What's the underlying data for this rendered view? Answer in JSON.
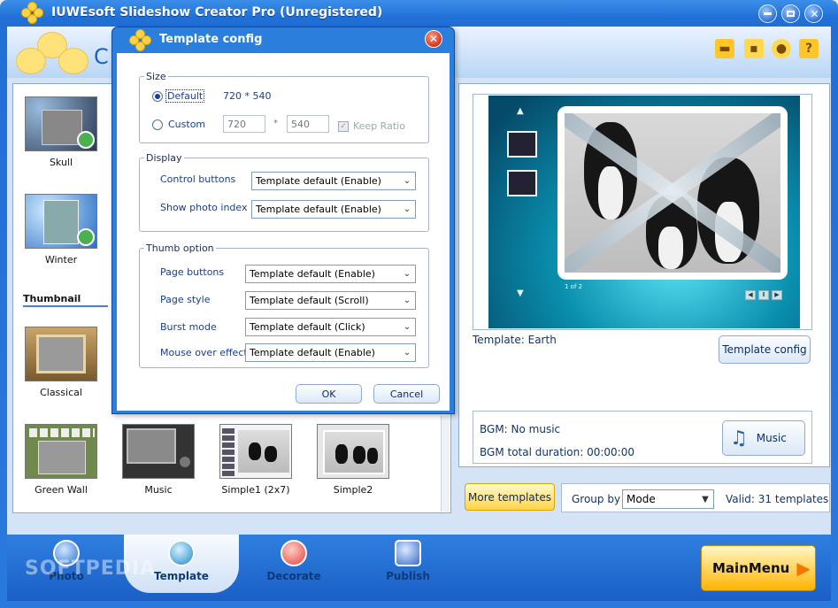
{
  "window": {
    "title": "IUWEsoft Slideshow Creator Pro (Unregistered)",
    "header_letter": "C"
  },
  "left_panel": {
    "templates": [
      {
        "label": "Skull"
      },
      {
        "label": "Winter"
      },
      {
        "label": "Classical"
      },
      {
        "label": "Green Wall"
      },
      {
        "label": "Music"
      },
      {
        "label": "Simple1 (2x7)"
      },
      {
        "label": "Simple2"
      }
    ],
    "section_title": "Thumbnail"
  },
  "preview": {
    "page_indicator": "1 of 2",
    "template_text": "Template: Earth",
    "template_config_button": "Template config"
  },
  "bgm": {
    "music": "BGM: No music",
    "duration": "BGM total duration: 00:00:00",
    "music_button": "Music"
  },
  "bottom_row": {
    "more_templates": "More templates",
    "group_by_label": "Group by",
    "group_by_value": "Mode",
    "valid": "Valid: 31 templates"
  },
  "nav": {
    "items": [
      "Photo",
      "Template",
      "Decorate",
      "Publish"
    ],
    "watermark": "SOFTPEDIA",
    "main_menu": "MainMenu"
  },
  "dialog": {
    "title": "Template config",
    "size": {
      "legend": "Size",
      "default_label": "Default",
      "default_value": "720 * 540",
      "custom_label": "Custom",
      "width": "720",
      "times": "*",
      "height": "540",
      "keep_ratio": "Keep Ratio"
    },
    "display": {
      "legend": "Display",
      "control_buttons_label": "Control buttons",
      "control_buttons_value": "Template default (Enable)",
      "show_photo_index_label": "Show photo index",
      "show_photo_index_value": "Template default (Enable)"
    },
    "thumb": {
      "legend": "Thumb option",
      "page_buttons_label": "Page buttons",
      "page_buttons_value": "Template default (Enable)",
      "page_style_label": "Page style",
      "page_style_value": "Template default (Scroll)",
      "burst_mode_label": "Burst mode",
      "burst_mode_value": "Template default (Click)",
      "mouse_over_label": "Mouse over effect",
      "mouse_over_value": "Template default (Enable)"
    },
    "ok": "OK",
    "cancel": "Cancel"
  },
  "colors": {
    "frame_blue": "#2a79de",
    "accent_yellow": "#ffd44a",
    "dialog_close_red": "#d7331a"
  }
}
